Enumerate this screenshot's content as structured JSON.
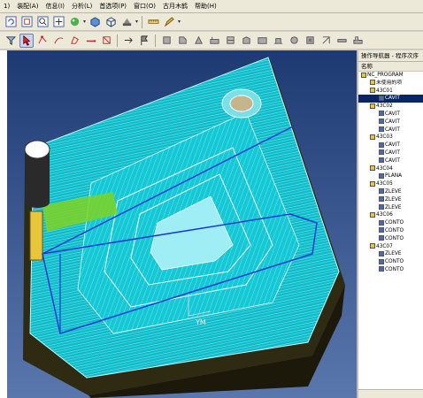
{
  "menu": [
    {
      "label": "1)"
    },
    {
      "label": "装配(A)"
    },
    {
      "label": "信息(I)"
    },
    {
      "label": "分析(L)"
    },
    {
      "label": "首选项(P)"
    },
    {
      "label": "窗口(O)"
    },
    {
      "label": "古月木鹤"
    },
    {
      "label": "帮助(H)"
    }
  ],
  "viewport": {
    "wcs_label": "YM",
    "colors": {
      "background_top": "#1d3a73",
      "background_bottom": "#5a77ad",
      "toolpath": "#19d9e6",
      "part_base": "#2f2a12",
      "highlight": "#7ed321"
    }
  },
  "navigator": {
    "title": "操作导航器 - 程序次序",
    "column_header": "名称",
    "items": [
      {
        "label": "NC_PROGRAM",
        "level": 0
      },
      {
        "label": "未使用的项",
        "level": 1
      },
      {
        "label": "43C01",
        "level": 1
      },
      {
        "label": "CAVIT",
        "level": 2,
        "selected": true
      },
      {
        "label": "43C02",
        "level": 1
      },
      {
        "label": "CAVIT",
        "level": 2
      },
      {
        "label": "CAVIT",
        "level": 2
      },
      {
        "label": "CAVIT",
        "level": 2
      },
      {
        "label": "43C03",
        "level": 1
      },
      {
        "label": "CAVIT",
        "level": 2
      },
      {
        "label": "CAVIT",
        "level": 2
      },
      {
        "label": "CAVIT",
        "level": 2
      },
      {
        "label": "43C04",
        "level": 1
      },
      {
        "label": "PLANA",
        "level": 2
      },
      {
        "label": "43C05",
        "level": 1
      },
      {
        "label": "ZLEVE",
        "level": 2
      },
      {
        "label": "ZLEVE",
        "level": 2
      },
      {
        "label": "ZLEVE",
        "level": 2
      },
      {
        "label": "43C06",
        "level": 1
      },
      {
        "label": "CONTO",
        "level": 2
      },
      {
        "label": "CONTO",
        "level": 2
      },
      {
        "label": "CONTO",
        "level": 2
      },
      {
        "label": "43C07",
        "level": 1
      },
      {
        "label": "ZLEVE",
        "level": 2
      },
      {
        "label": "CONTO",
        "level": 2
      },
      {
        "label": "CONTO",
        "level": 2
      }
    ]
  }
}
